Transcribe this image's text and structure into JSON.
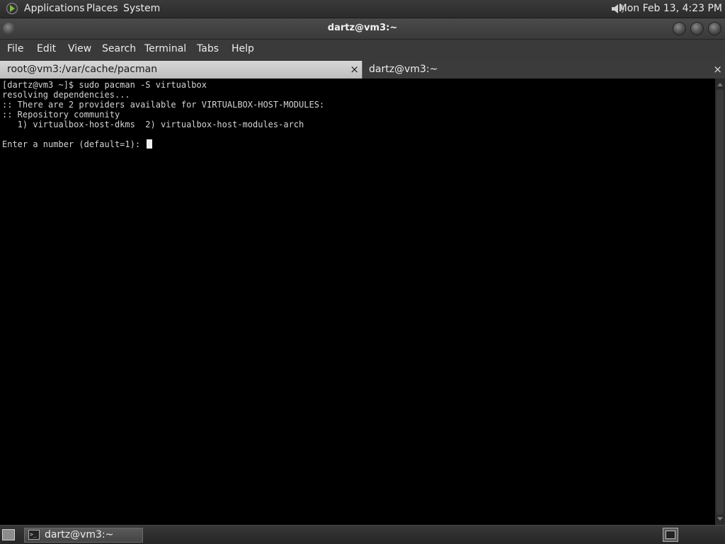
{
  "top_panel": {
    "apps_icon": "gnome-foot-icon",
    "applications": "Applications",
    "places": "Places",
    "system": "System",
    "volume_icon": "speaker-icon",
    "clock": "Mon Feb 13,  4:23 PM"
  },
  "window": {
    "title": "dartz@vm3:~",
    "controls": [
      "minimize-icon",
      "maximize-icon",
      "close-icon"
    ]
  },
  "menubar": {
    "file": "File",
    "edit": "Edit",
    "view": "View",
    "search": "Search",
    "terminal": "Terminal",
    "tabs": "Tabs",
    "help": "Help"
  },
  "tabs": [
    {
      "label": "root@vm3:/var/cache/pacman",
      "close": "×",
      "active": false
    },
    {
      "label": "dartz@vm3:~",
      "close": "×",
      "active": true
    }
  ],
  "terminal": {
    "lines": [
      "[dartz@vm3 ~]$ sudo pacman -S virtualbox",
      "resolving dependencies...",
      ":: There are 2 providers available for VIRTUALBOX-HOST-MODULES:",
      ":: Repository community",
      "   1) virtualbox-host-dkms  2) virtualbox-host-modules-arch",
      "",
      "Enter a number (default=1): "
    ]
  },
  "taskbar": {
    "show_desktop_icon": "show-desktop-icon",
    "item_label": "dartz@vm3:~",
    "item_icon": "terminal-icon",
    "workspace_icon": "workspace-switcher-icon"
  }
}
